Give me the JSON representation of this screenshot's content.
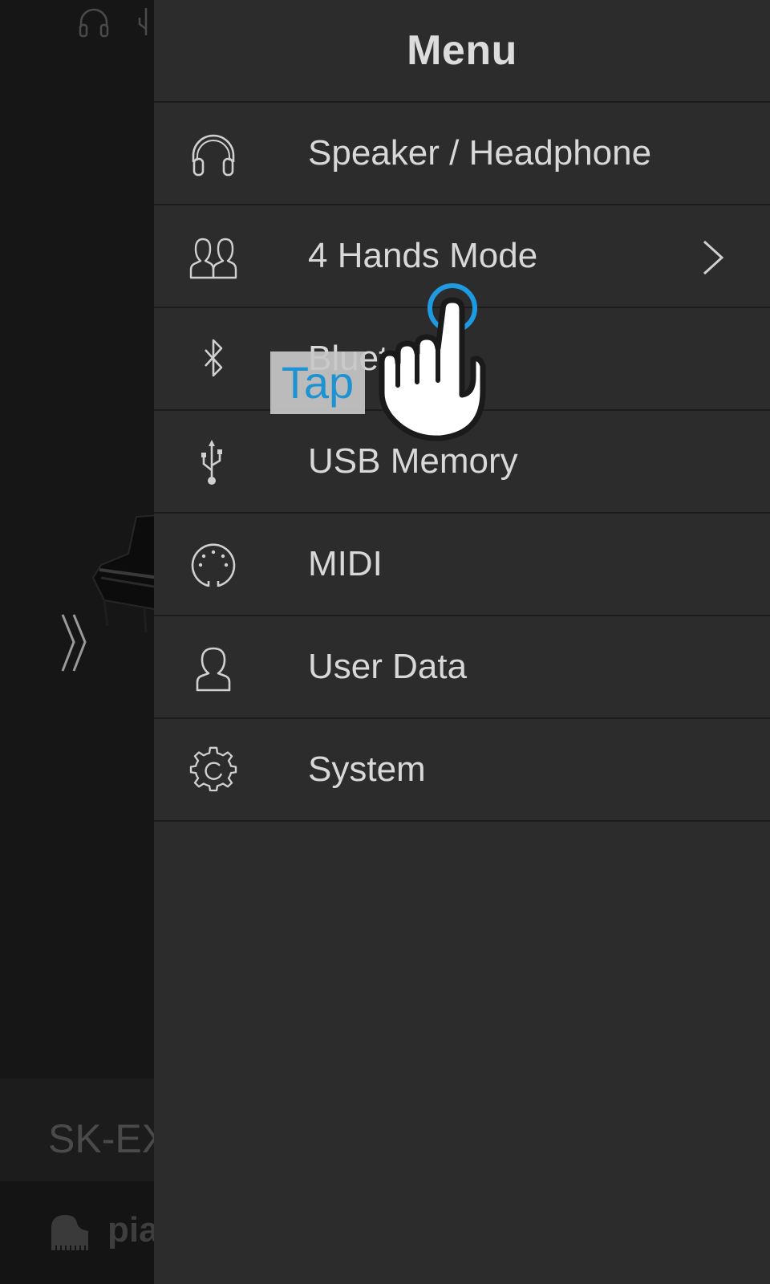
{
  "background": {
    "model_name": "SK-EX",
    "bottom_label": "pia",
    "icons": {
      "headphone": "headphone-icon",
      "usb": "usb-icon",
      "expand": "double-chevron-right-icon",
      "piano": "grand-piano-icon"
    }
  },
  "menu": {
    "title": "Menu",
    "items": [
      {
        "label": "Speaker / Headphone",
        "icon": "headphone-icon",
        "has_chevron": false
      },
      {
        "label": "4 Hands Mode",
        "icon": "two-people-icon",
        "has_chevron": true
      },
      {
        "label": "Bluetooth",
        "icon": "bluetooth-icon",
        "has_chevron": false
      },
      {
        "label": "USB Memory",
        "icon": "usb-icon",
        "has_chevron": false
      },
      {
        "label": "MIDI",
        "icon": "midi-port-icon",
        "has_chevron": false
      },
      {
        "label": "User Data",
        "icon": "user-icon",
        "has_chevron": false
      },
      {
        "label": "System",
        "icon": "gear-icon",
        "has_chevron": false
      }
    ]
  },
  "tap_hint": {
    "label": "Tap",
    "icon": "pointing-hand-icon"
  },
  "colors": {
    "drawer_bg": "#2c2c2c",
    "divider": "#1d1d1d",
    "text": "#d8d8d8",
    "accent": "#1e9be0"
  }
}
